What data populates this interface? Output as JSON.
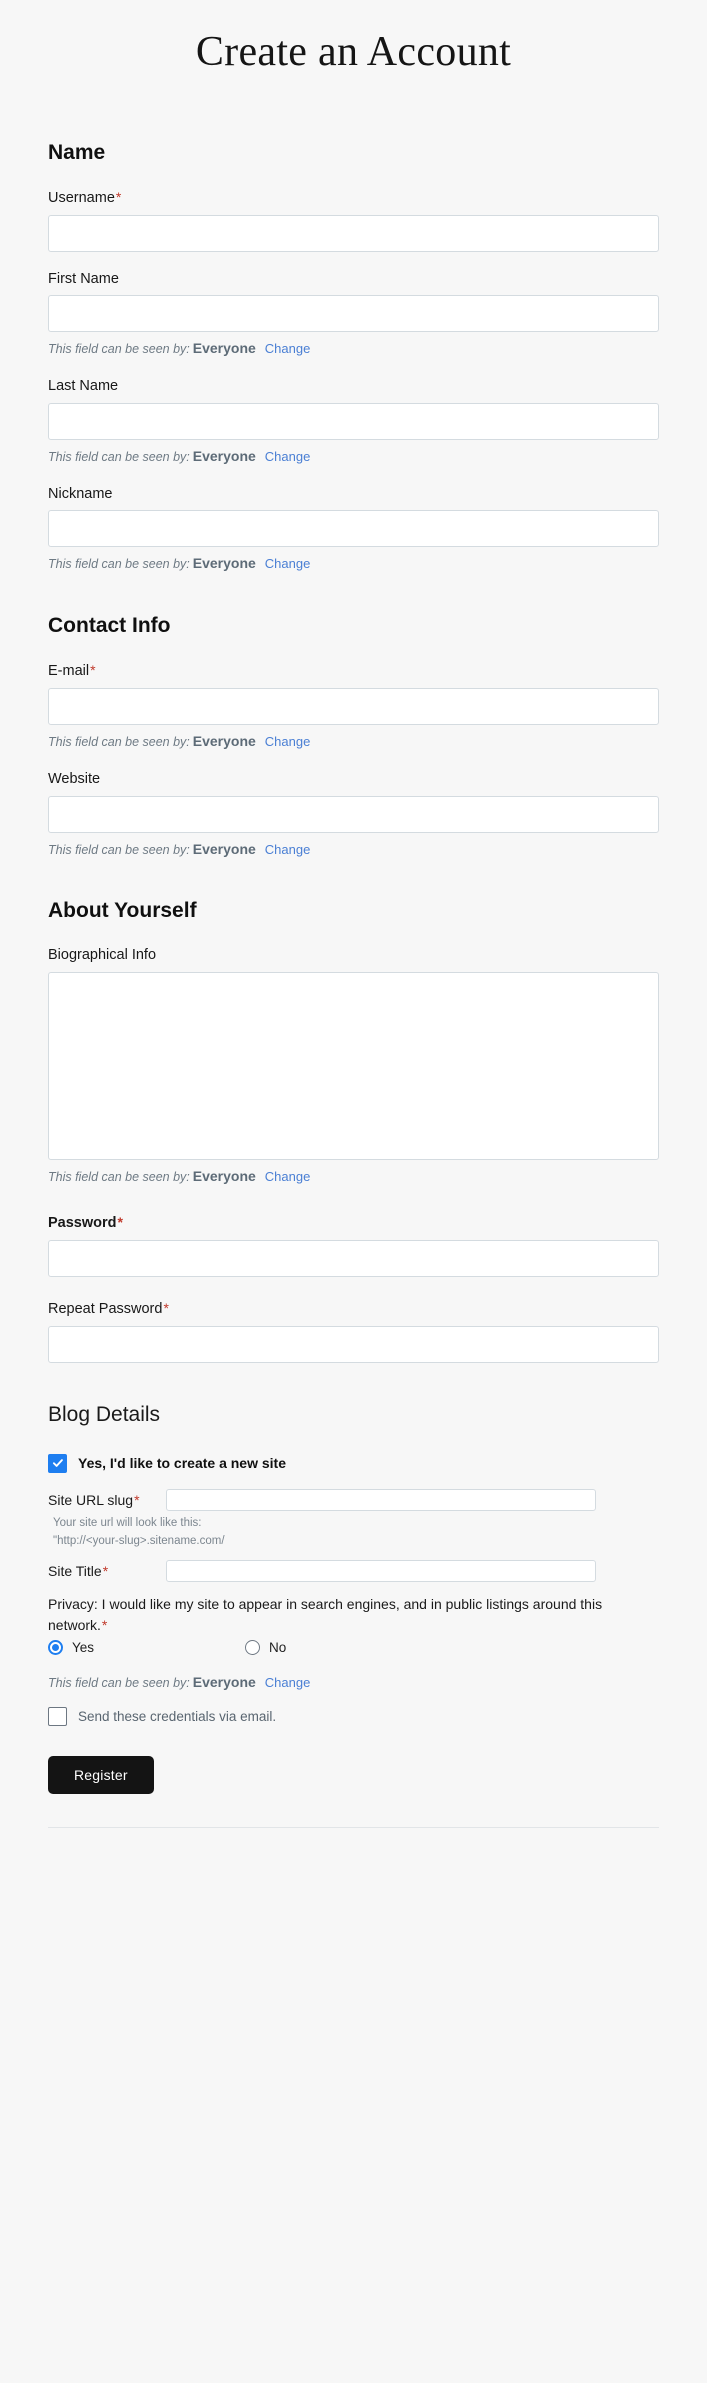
{
  "page": {
    "title": "Create an Account"
  },
  "visibility_note": {
    "prefix": "This field can be seen by:",
    "level": "Everyone",
    "change_label": "Change"
  },
  "sections": {
    "name": {
      "heading": "Name",
      "fields": {
        "username": {
          "label": "Username",
          "required_mark": "*",
          "value": ""
        },
        "first_name": {
          "label": "First Name",
          "value": ""
        },
        "last_name": {
          "label": "Last Name",
          "value": ""
        },
        "nickname": {
          "label": "Nickname",
          "value": ""
        }
      }
    },
    "contact": {
      "heading": "Contact Info",
      "fields": {
        "email": {
          "label": "E-mail",
          "required_mark": "*",
          "value": ""
        },
        "website": {
          "label": "Website",
          "value": ""
        }
      }
    },
    "about": {
      "heading": "About Yourself",
      "fields": {
        "bio": {
          "label": "Biographical Info",
          "value": ""
        },
        "password": {
          "label": "Password",
          "required_mark": "*",
          "value": ""
        },
        "repeat_password": {
          "label": "Repeat Password",
          "required_mark": "*",
          "value": ""
        }
      }
    },
    "blog": {
      "heading": "Blog Details",
      "create_site_checkbox": {
        "label": "Yes, I'd like to create a new site",
        "checked": true
      },
      "site_slug": {
        "label": "Site URL slug",
        "required_mark": "*",
        "value": "",
        "helper_line_1": "Your site url will look like this:",
        "helper_line_2": "\"http://<your-slug>.sitename.com/"
      },
      "site_title": {
        "label": "Site Title",
        "required_mark": "*",
        "value": ""
      },
      "privacy": {
        "text": "Privacy: I would like my site to appear in search engines, and in public listings around this network.",
        "required_mark": "*",
        "options": [
          {
            "label": "Yes",
            "selected": true
          },
          {
            "label": "No",
            "selected": false
          }
        ]
      },
      "send_credentials_checkbox": {
        "label": "Send these credentials via email.",
        "checked": false
      }
    }
  },
  "submit": {
    "register_label": "Register"
  },
  "colors": {
    "accent_blue": "#1e7ef0",
    "link_blue": "#4a7fd4",
    "required_red": "#c0392b",
    "button_dark": "#141414",
    "page_bg": "#f7f7f7"
  }
}
